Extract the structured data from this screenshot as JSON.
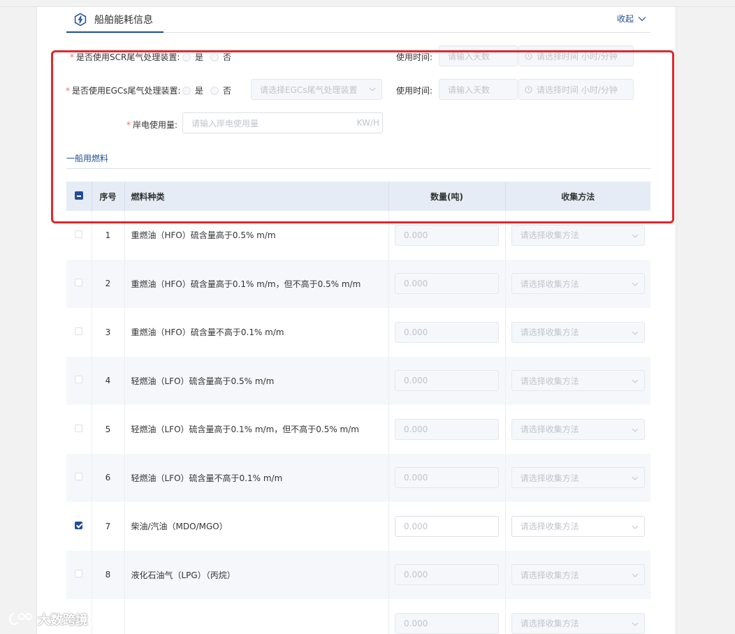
{
  "section": {
    "title": "船舶能耗信息",
    "collapse_label": "收起"
  },
  "scr": {
    "label": "是否使用SCR尾气处理装置:",
    "yes": "是",
    "no": "否",
    "time_label": "使用时间:",
    "days_placeholder": "请输入天数",
    "time_placeholder": "请选择时间 小时/分钟"
  },
  "egcs": {
    "label": "是否使用EGCs尾气处理装置:",
    "yes": "是",
    "no": "否",
    "select_placeholder": "请选择EGCs尾气处理装置",
    "time_label": "使用时间:",
    "days_placeholder": "请输入天数",
    "time_placeholder": "请选择时间 小时/分钟"
  },
  "shore": {
    "label": "岸电使用量:",
    "placeholder": "请输入岸电使用量",
    "unit": "KW/H"
  },
  "fuel_section": {
    "title": "一船用燃料"
  },
  "table": {
    "headers": {
      "index": "序号",
      "fuel_type": "燃料种类",
      "quantity": "数量(吨)",
      "method": "收集方法"
    },
    "rows": [
      {
        "index": "1",
        "fuel": "重燃油（HFO）硫含量高于0.5% m/m",
        "qty": "0.000",
        "method": "请选择收集方法",
        "checked": false
      },
      {
        "index": "2",
        "fuel": "重燃油（HFO）硫含量高于0.1% m/m，但不高于0.5% m/m",
        "qty": "0.000",
        "method": "请选择收集方法",
        "checked": false
      },
      {
        "index": "3",
        "fuel": "重燃油（HFO）硫含量不高于0.1% m/m",
        "qty": "0.000",
        "method": "请选择收集方法",
        "checked": false
      },
      {
        "index": "4",
        "fuel": "轻燃油（LFO）硫含量高于0.5% m/m",
        "qty": "0.000",
        "method": "请选择收集方法",
        "checked": false
      },
      {
        "index": "5",
        "fuel": "轻燃油（LFO）硫含量高于0.1% m/m，但不高于0.5% m/m",
        "qty": "0.000",
        "method": "请选择收集方法",
        "checked": false
      },
      {
        "index": "6",
        "fuel": "轻燃油（LFO）硫含量不高于0.1% m/m",
        "qty": "0.000",
        "method": "请选择收集方法",
        "checked": false
      },
      {
        "index": "7",
        "fuel": "柴油/汽油（MDO/MGO）",
        "qty": "0.000",
        "method": "请选择收集方法",
        "checked": true
      },
      {
        "index": "8",
        "fuel": "液化石油气（LPG）（丙烷）",
        "qty": "0.000",
        "method": "请选择收集方法",
        "checked": false
      },
      {
        "index": "",
        "fuel": "",
        "qty": "0.000",
        "method": "请选择收集方法",
        "checked": false
      }
    ]
  },
  "watermark": {
    "text": "大数跨境"
  }
}
